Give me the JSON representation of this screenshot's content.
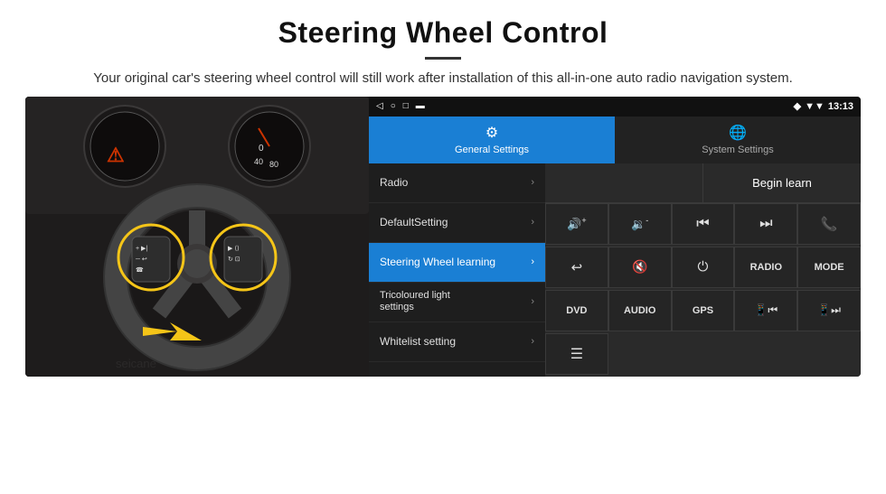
{
  "header": {
    "title": "Steering Wheel Control",
    "subtitle": "Your original car's steering wheel control will still work after installation of this all-in-one auto radio navigation system."
  },
  "status_bar": {
    "time": "13:13",
    "signal_icon": "♥▼",
    "location_icon": "◆"
  },
  "tabs": [
    {
      "id": "general",
      "label": "General Settings",
      "icon": "⚙",
      "active": true
    },
    {
      "id": "system",
      "label": "System Settings",
      "icon": "🌐",
      "active": false
    }
  ],
  "menu": {
    "items": [
      {
        "id": "radio",
        "label": "Radio",
        "active": false
      },
      {
        "id": "default",
        "label": "DefaultSetting",
        "active": false
      },
      {
        "id": "steering",
        "label": "Steering Wheel learning",
        "active": true
      },
      {
        "id": "tricoloured",
        "label": "Tricoloured light settings",
        "active": false
      },
      {
        "id": "whitelist",
        "label": "Whitelist setting",
        "active": false
      }
    ]
  },
  "right_panel": {
    "begin_learn_label": "Begin learn",
    "control_buttons": [
      {
        "id": "vol_up",
        "icon": "🔊+",
        "label": "vol-up"
      },
      {
        "id": "vol_down",
        "icon": "🔉-",
        "label": "vol-down"
      },
      {
        "id": "prev",
        "icon": "⏮",
        "label": "prev"
      },
      {
        "id": "next",
        "icon": "⏭",
        "label": "next"
      },
      {
        "id": "phone",
        "icon": "📞",
        "label": "phone"
      },
      {
        "id": "back",
        "icon": "↩",
        "label": "back"
      },
      {
        "id": "mute",
        "icon": "🔇",
        "label": "mute"
      },
      {
        "id": "power",
        "icon": "⏻",
        "label": "power"
      },
      {
        "id": "radio_btn",
        "text": "RADIO",
        "label": "radio-button"
      },
      {
        "id": "mode",
        "text": "MODE",
        "label": "mode-button"
      },
      {
        "id": "dvd",
        "text": "DVD",
        "label": "dvd-button"
      },
      {
        "id": "audio",
        "text": "AUDIO",
        "label": "audio-button"
      },
      {
        "id": "gps",
        "text": "GPS",
        "label": "gps-button"
      },
      {
        "id": "tel_prev",
        "icon": "📱⏮",
        "label": "tel-prev"
      },
      {
        "id": "tel_next",
        "icon": "📱⏭",
        "label": "tel-next"
      },
      {
        "id": "list",
        "icon": "☰",
        "label": "list"
      }
    ]
  },
  "nav_icons": [
    "◁",
    "○",
    "□",
    "▬"
  ],
  "watermark": "seicane"
}
